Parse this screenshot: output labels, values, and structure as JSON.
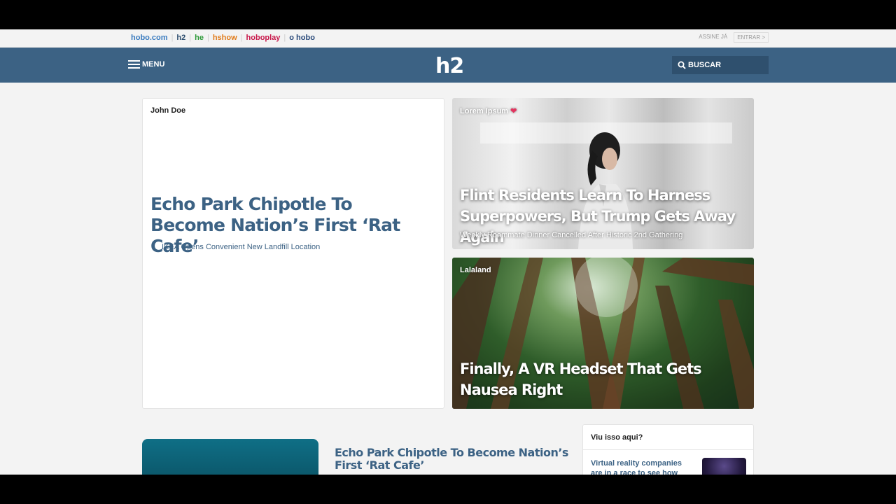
{
  "network": {
    "links": [
      {
        "label": "hobo.com",
        "color": "#3a7bbf"
      },
      {
        "label": "h2",
        "color": "#2f4f6f"
      },
      {
        "label": "he",
        "color": "#2f9a3a"
      },
      {
        "label": "hshow",
        "color": "#e07b1a"
      },
      {
        "label": "hoboplay",
        "color": "#c8184a"
      },
      {
        "label": "o hobo",
        "color": "#2a4a7a"
      }
    ],
    "subscribe_label": "ASSINE JÁ",
    "login_label": "ENTRAR >"
  },
  "header": {
    "menu_label": "MENU",
    "logo": "h2",
    "search_label": "BUSCAR"
  },
  "main_card": {
    "author": "John Doe",
    "title": "Echo Park Chipotle To Become Nation’s First ‘Rat Cafe’",
    "related": [
      "IKEA Opens Convenient New Landfill Location"
    ]
  },
  "card_1": {
    "tag": "Lorem Ipsum",
    "title": "Flint Residents Learn To Harness Superpowers, But Trump Gets Away Again",
    "subtitle": "Weekly Roommate Dinner Cancelled After Historic 2nd Gathering"
  },
  "card_2": {
    "tag": "Lalaland",
    "title": "Finally, A VR Headset That Gets Nausea Right"
  },
  "lower": {
    "title": "Echo Park Chipotle To Become Nation’s First ‘Rat Cafe’"
  },
  "sidebar": {
    "heading": "Viu isso aqui?",
    "item_title": "Virtual reality companies are in a race to see how"
  },
  "colors": {
    "brand": "#3c6284",
    "heart": "#e3345f"
  }
}
